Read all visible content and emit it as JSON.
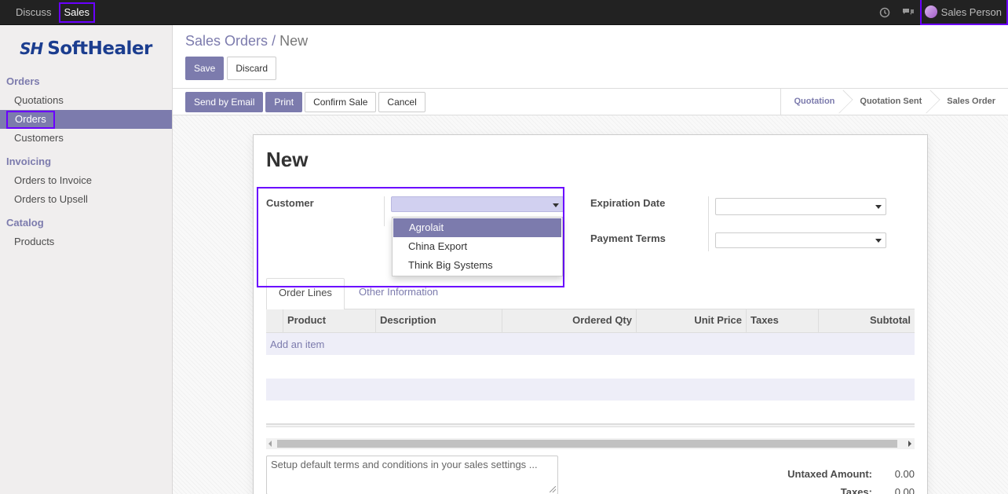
{
  "topbar": {
    "menu": [
      "Discuss",
      "Sales"
    ],
    "active_menu": "Sales",
    "user_name": "Sales Person"
  },
  "sidebar": {
    "logo_text": "SoftHealer",
    "logo_mark": "SH",
    "sections": [
      {
        "heading": "Orders",
        "items": [
          "Quotations",
          "Orders",
          "Customers"
        ]
      },
      {
        "heading": "Invoicing",
        "items": [
          "Orders to Invoice",
          "Orders to Upsell"
        ]
      },
      {
        "heading": "Catalog",
        "items": [
          "Products"
        ]
      }
    ],
    "active_item": "Orders"
  },
  "control_panel": {
    "breadcrumb_parent": "Sales Orders",
    "breadcrumb_sep": "/",
    "breadcrumb_current": "New",
    "save_label": "Save",
    "discard_label": "Discard"
  },
  "statusbar": {
    "buttons": [
      "Send by Email",
      "Print",
      "Confirm Sale",
      "Cancel"
    ],
    "stages": [
      "Quotation",
      "Quotation Sent",
      "Sales Order"
    ],
    "current_stage": "Quotation"
  },
  "form": {
    "title": "New",
    "customer_label": "Customer",
    "customer_value": "",
    "customer_options": [
      "Agrolait",
      "China Export",
      "Think Big Systems"
    ],
    "customer_highlighted_option": "Agrolait",
    "expiration_label": "Expiration Date",
    "payment_terms_label": "Payment Terms",
    "tabs": [
      "Order Lines",
      "Other Information"
    ],
    "active_tab": "Order Lines",
    "columns": [
      "Product",
      "Description",
      "Ordered Qty",
      "Unit Price",
      "Taxes",
      "Subtotal"
    ],
    "add_item_label": "Add an item",
    "notes_placeholder": "Setup default terms and conditions in your sales settings ...",
    "totals": [
      {
        "label": "Untaxed Amount:",
        "value": "0.00"
      },
      {
        "label": "Taxes:",
        "value": "0.00"
      }
    ]
  },
  "colors": {
    "brand": "#7c7bad",
    "highlight_outline": "#6a00ff",
    "logo_blue": "#1b3d8f"
  }
}
